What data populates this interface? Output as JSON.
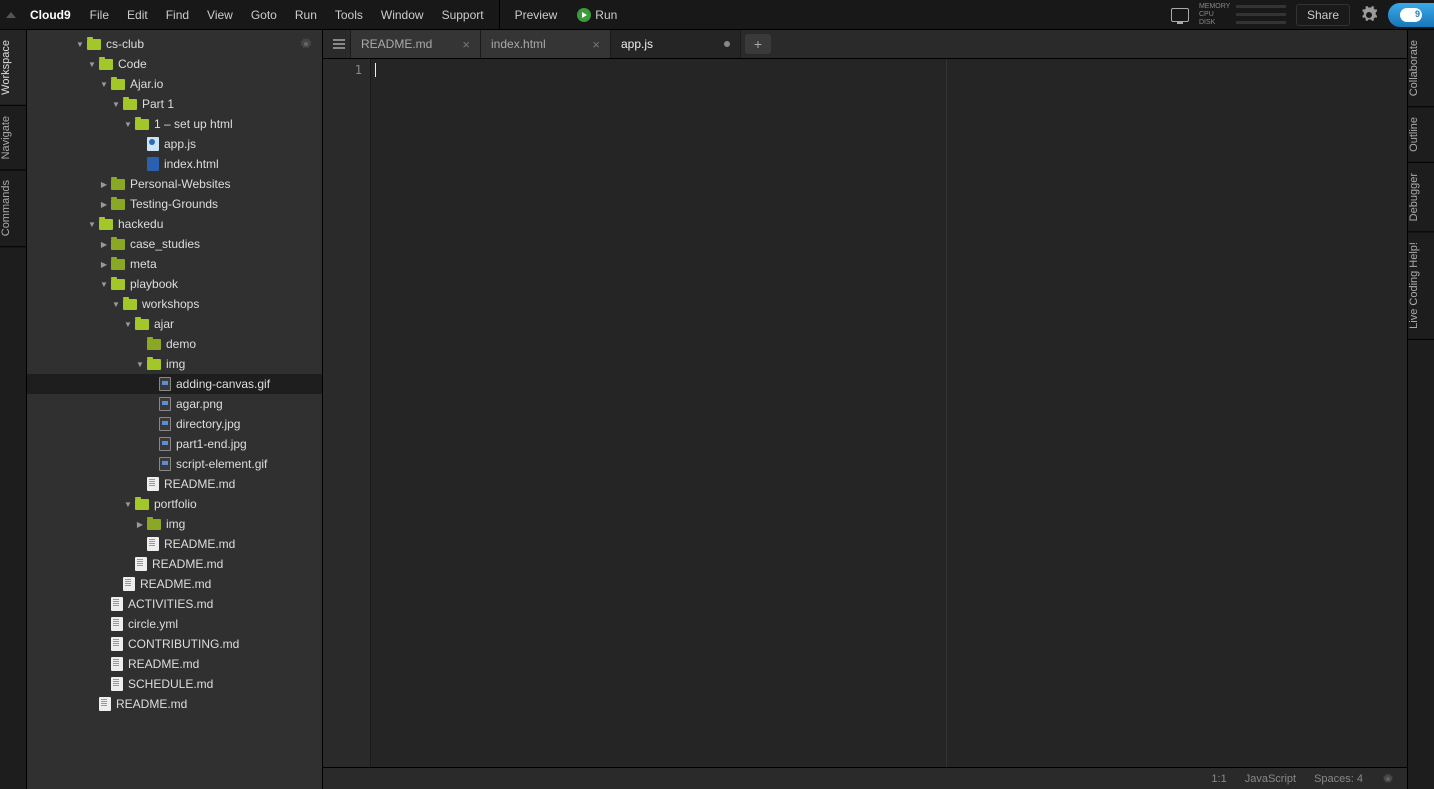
{
  "brand": "Cloud9",
  "menu": [
    "File",
    "Edit",
    "Find",
    "View",
    "Goto",
    "Run",
    "Tools",
    "Window",
    "Support"
  ],
  "preview": "Preview",
  "run": "Run",
  "meters": [
    "MEMORY",
    "CPU",
    "DISK"
  ],
  "share": "Share",
  "left_rail": [
    "Workspace",
    "Navigate",
    "Commands"
  ],
  "right_rail": [
    "Collaborate",
    "Outline",
    "Debugger",
    "Live Coding Help!"
  ],
  "tree": [
    {
      "d": 0,
      "t": "folder",
      "o": true,
      "n": "cs-club"
    },
    {
      "d": 1,
      "t": "folder",
      "o": true,
      "n": "Code"
    },
    {
      "d": 2,
      "t": "folder",
      "o": true,
      "n": "Ajar.io"
    },
    {
      "d": 3,
      "t": "folder",
      "o": true,
      "n": "Part 1"
    },
    {
      "d": 4,
      "t": "folder",
      "o": true,
      "n": "1 – set up html"
    },
    {
      "d": 5,
      "t": "file",
      "k": "js",
      "n": "app.js"
    },
    {
      "d": 5,
      "t": "file",
      "k": "html",
      "n": "index.html"
    },
    {
      "d": 2,
      "t": "folder",
      "o": false,
      "n": "Personal-Websites"
    },
    {
      "d": 2,
      "t": "folder",
      "o": false,
      "n": "Testing-Grounds"
    },
    {
      "d": 1,
      "t": "folder",
      "o": true,
      "n": "hackedu"
    },
    {
      "d": 2,
      "t": "folder",
      "o": false,
      "n": "case_studies"
    },
    {
      "d": 2,
      "t": "folder",
      "o": false,
      "n": "meta"
    },
    {
      "d": 2,
      "t": "folder",
      "o": true,
      "n": "playbook"
    },
    {
      "d": 3,
      "t": "folder",
      "o": true,
      "n": "workshops"
    },
    {
      "d": 4,
      "t": "folder",
      "o": true,
      "n": "ajar"
    },
    {
      "d": 5,
      "t": "folder",
      "o": null,
      "n": "demo"
    },
    {
      "d": 5,
      "t": "folder",
      "o": true,
      "n": "img"
    },
    {
      "d": 6,
      "t": "file",
      "k": "img",
      "n": "adding-canvas.gif",
      "sel": true
    },
    {
      "d": 6,
      "t": "file",
      "k": "img",
      "n": "agar.png"
    },
    {
      "d": 6,
      "t": "file",
      "k": "img",
      "n": "directory.jpg"
    },
    {
      "d": 6,
      "t": "file",
      "k": "img",
      "n": "part1-end.jpg"
    },
    {
      "d": 6,
      "t": "file",
      "k": "img",
      "n": "script-element.gif"
    },
    {
      "d": 5,
      "t": "file",
      "k": "md",
      "n": "README.md"
    },
    {
      "d": 4,
      "t": "folder",
      "o": true,
      "n": "portfolio"
    },
    {
      "d": 5,
      "t": "folder",
      "o": false,
      "n": "img"
    },
    {
      "d": 5,
      "t": "file",
      "k": "md",
      "n": "README.md"
    },
    {
      "d": 4,
      "t": "file",
      "k": "md",
      "n": "README.md"
    },
    {
      "d": 3,
      "t": "file",
      "k": "md",
      "n": "README.md"
    },
    {
      "d": 2,
      "t": "file",
      "k": "md",
      "n": "ACTIVITIES.md"
    },
    {
      "d": 2,
      "t": "file",
      "k": "md",
      "n": "circle.yml"
    },
    {
      "d": 2,
      "t": "file",
      "k": "md",
      "n": "CONTRIBUTING.md"
    },
    {
      "d": 2,
      "t": "file",
      "k": "md",
      "n": "README.md"
    },
    {
      "d": 2,
      "t": "file",
      "k": "md",
      "n": "SCHEDULE.md"
    },
    {
      "d": 1,
      "t": "file",
      "k": "md",
      "n": "README.md"
    }
  ],
  "tabs": [
    {
      "name": "README.md",
      "active": false,
      "dirty": false
    },
    {
      "name": "index.html",
      "active": false,
      "dirty": false
    },
    {
      "name": "app.js",
      "active": true,
      "dirty": true
    }
  ],
  "line_number": "1",
  "status": {
    "pos": "1:1",
    "lang": "JavaScript",
    "spaces": "Spaces: 4"
  }
}
